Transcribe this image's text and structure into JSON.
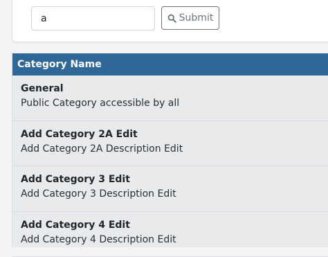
{
  "search": {
    "value": "a",
    "submit_label": "Submit"
  },
  "table": {
    "header": "Category Name",
    "rows": [
      {
        "name": "General",
        "description": "Public Category accessible by all"
      },
      {
        "name": "Add Category 2A Edit",
        "description": "Add Category 2A Description Edit"
      },
      {
        "name": "Add Category 3 Edit",
        "description": "Add Category 3 Description Edit"
      },
      {
        "name": "Add Category 4 Edit",
        "description": "Add Category 4 Description Edit"
      }
    ]
  },
  "icons": {
    "submit": "search-icon"
  },
  "colors": {
    "header_bg": "#2f6898",
    "row_bg": "#e9eaec",
    "button_border": "#6c757d"
  }
}
